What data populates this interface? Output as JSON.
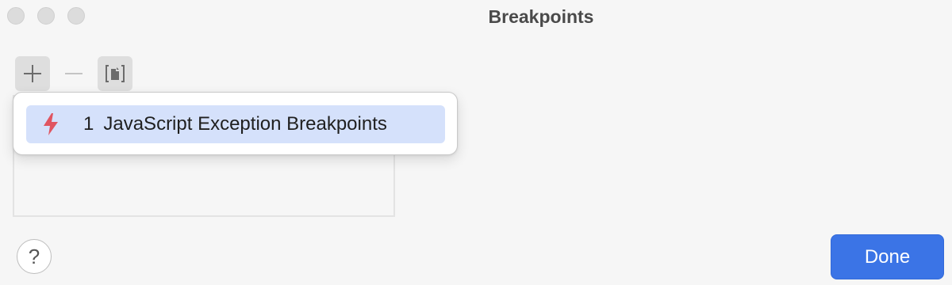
{
  "window": {
    "title": "Breakpoints"
  },
  "toolbar": {
    "add_icon": "plus-icon",
    "remove_icon": "minus-icon",
    "group_icon": "group-by-file-icon"
  },
  "popup": {
    "items": [
      {
        "icon": "lightning-bolt-icon",
        "number": "1",
        "label": "JavaScript Exception Breakpoints"
      }
    ]
  },
  "footer": {
    "help_label": "?",
    "done_label": "Done"
  },
  "colors": {
    "accent": "#3b74e6",
    "selection": "#d5e1fb",
    "bolt": "#e05561"
  }
}
